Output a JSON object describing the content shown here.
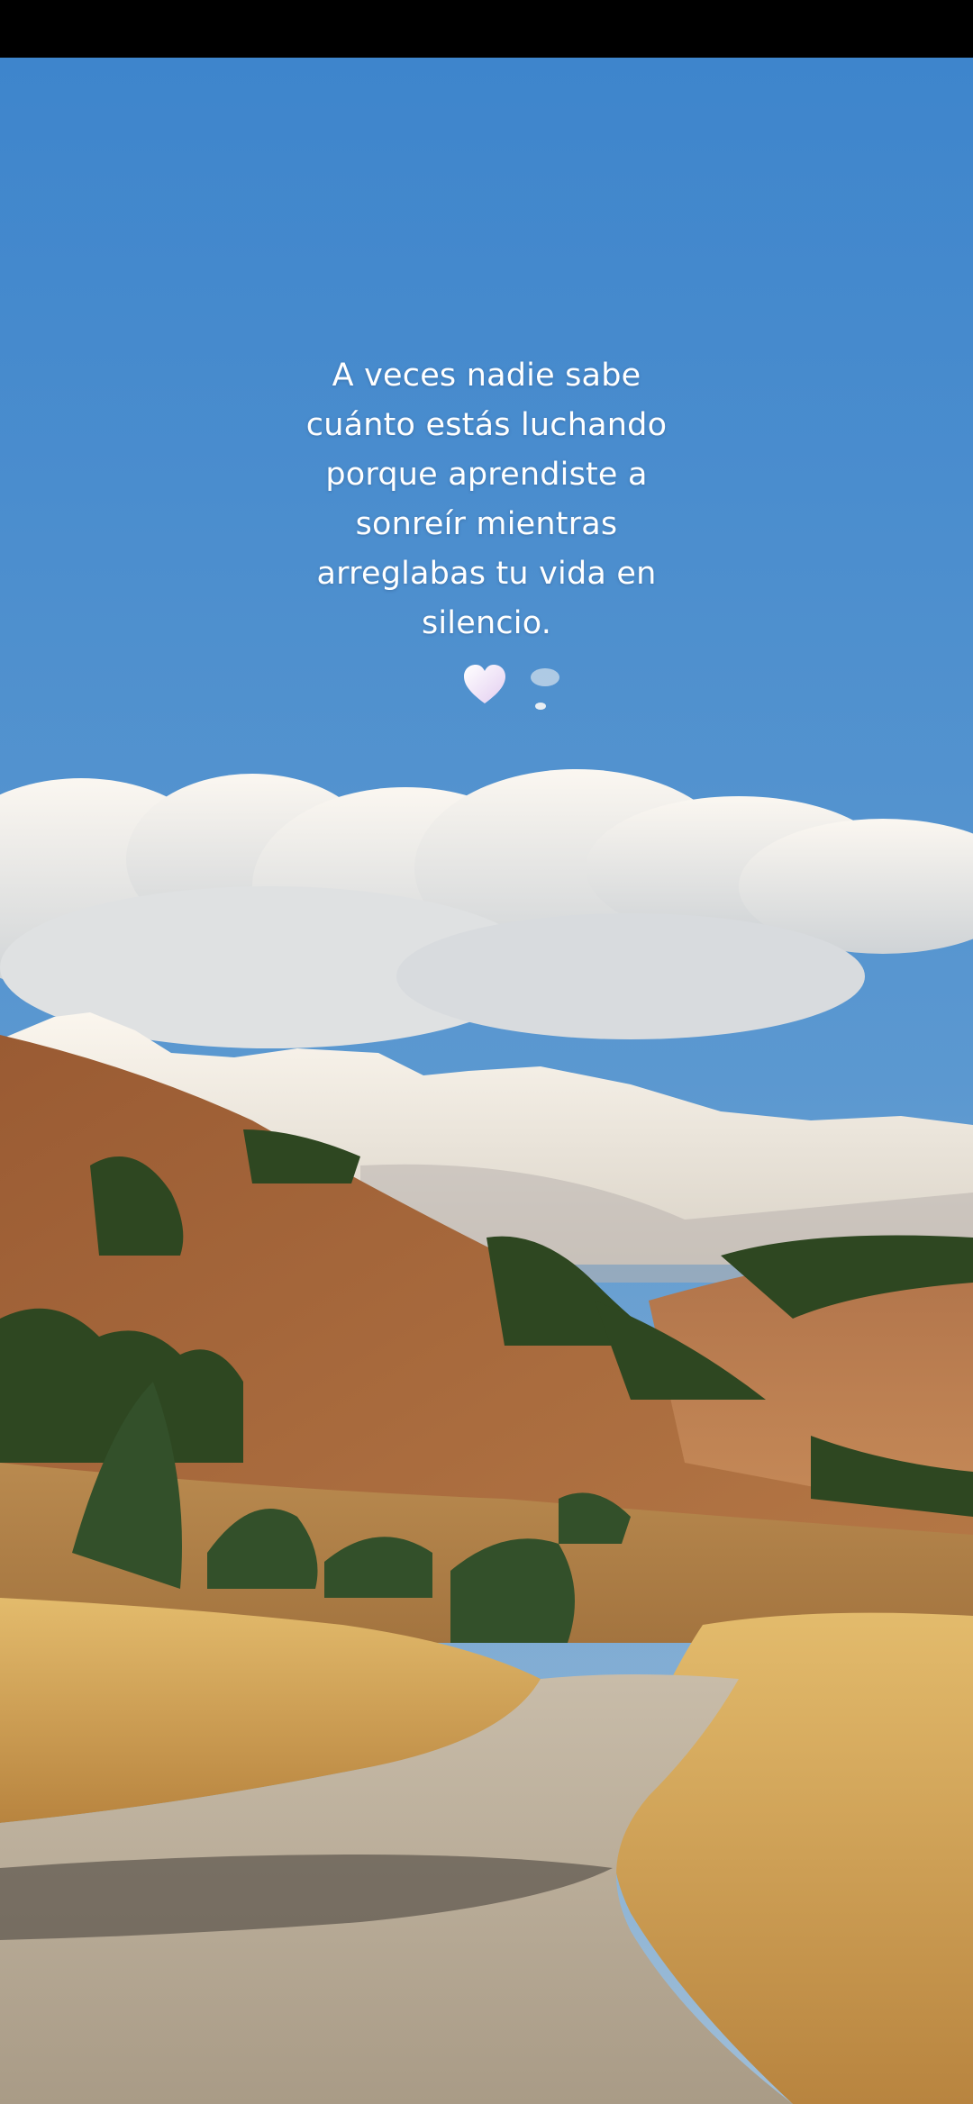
{
  "quote": {
    "lines": [
      "A veces nadie sabe",
      "cuánto estás luchando",
      "porque aprendiste a",
      "sonreír mientras",
      "arreglabas tu vida en",
      "silencio."
    ],
    "emoji": "heart-icon"
  },
  "scene": {
    "description_items": [
      "sky",
      "clouds",
      "snow-capped-mountains",
      "hills",
      "trees",
      "dirt-road",
      "dry-grass"
    ],
    "colors": {
      "sky_top": "#3f86cc",
      "sky_bottom": "#8fb6d6",
      "cloud": "#f4ede4",
      "snow": "#f3ecdf",
      "hill": "#a86a3c",
      "tree": "#2f4a22",
      "road": "#b7aa97",
      "grass": "#d9ad5e"
    }
  }
}
